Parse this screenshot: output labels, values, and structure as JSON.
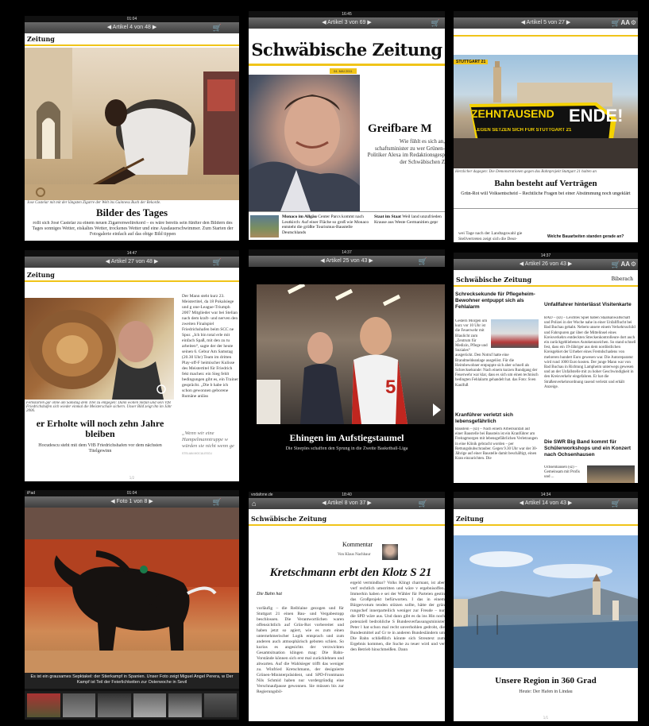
{
  "tiles": [
    {
      "time": "01:04",
      "nav": "Artikel 4 von 48",
      "masthead": "Zeitung",
      "caption": "Jose Castelar mit mit der längsten Zigarre der Welt ins Guinness Buch der Rekorde.",
      "headline": "Bilder des Tages",
      "body": "rollt sich José Castelar zu einem neuen Zigarrenweltrekord – es wäre bereits sein fünfter den Bildern des Tages sonniges Wetter, eiskaltes Wetter, trockenes Wetter und eine Ausdauerschwimmer. Zum Starten der Fotogalerie einfach auf das obige Bild tippen"
    },
    {
      "time": "16:45",
      "nav": "Artikel 3 von 69",
      "masthead": "Schwäbische Zeitung",
      "date": "04. MAI 2011",
      "headline": "Greifbare M",
      "body": "Wie fühlt es sich an, schaftsminister zu wer Grünen-Politiker Alexa im Redaktionsgesp der Schwäbischen Z",
      "teaser1_title": "Monaco im Allgäu",
      "teaser1": "Center Parcs kommt nach Leutkirch: Auf einer Fläche so groß wie Monaco entsteht die größte Tourismus-Baustelle Deutschlands",
      "teaser2_title": "Staat im Staat",
      "teaser2": "Weil land unzufrieden Krause aus Weste Germanitien gepr"
    },
    {
      "time": "",
      "nav": "Artikel 5 von 27",
      "kicker": "STUTTGART 21",
      "banner1": "ZEHNTAUSEND",
      "banner2": "ENDE!",
      "banner3": "LEGEN SETZEN SICH FÜR STUTTGART 21",
      "caption": "Herzlicher dagegen: Die Demonstrationen gegen das Bahnprojekt Stuttgart 21 halten an",
      "headline": "Bahn besteht auf Verträgen",
      "sub": "Grün-Rot will Volksentscheid – Rechtliche Fragen bei einer Abstimmung noch ungeklärt",
      "body": "wei Tage nach der Landtagswahl gie Stellvertreten zeigt sich die Deut-",
      "aside": "Welche Bauarbeiten standen gerade an?"
    },
    {
      "time": "14:47",
      "nav": "Artikel 27 von 48",
      "masthead": "Zeitung",
      "caption": "Fehlstarten gar ohne am Samstag dem Titel zu entgegen: Dann wollen Stefan und sein VfB Friedrichshafen sich wieder einmal die Meisterschale sichern. Unser Bild zeigt ihn im Jahr 2006.",
      "headline": "er Erholte will noch zehn Jahre bleiben",
      "sub": "Hocudescu steht mit dem VfB Friedrichshafen vor dem nächsten Titelgewinn",
      "col": "Der Mann steht kurz 23. Meistertitel, da 18 Pokalsiege und g one-League-Triumph 2007 Mitglieder war bei Stelian nach dem kraft- und nerven den zweiten Finalspiel Friedrichshafen beim SCC ne Spur. „Ich bin total erle mit einfach Spaß, mit den zu tu arbeiten“, sagte der der heute seinen 6. Gebur Am Samstag (20.30 Uhr) Team im dritten Play-off-F heimischer Kulisse des Meistertitel für Friedrich fekt machen: ein Sieg fehlt bedingungen gibt es, ein Trainer gesprächt. „Die b habe ich schon gewonnen geborene Rumäne anläss",
      "quote": "„Wenn wir eine Hampelmanntruppe w würden sie nicht wenn ge",
      "quote_by": "STELIAN MOCULESCU",
      "page": "1/2"
    },
    {
      "time": "14:37",
      "nav": "Artikel 25 von 43",
      "jersey": "5",
      "headline": "Ehingen im Aufstiegstaumel",
      "sub": "Die Steeples schaffen den Sprung in die Zweite Basketball-Liga"
    },
    {
      "time": "14:37",
      "nav": "Artikel 26 von 43",
      "masthead": "Schwäbische Zeitung",
      "region": "Biberach",
      "left": [
        {
          "title": "Schrecksekunde für Pflegeheim-Bewohner entpuppt sich als Fehlalarm",
          "body": "Gestern Morgen um kurz vor 10 Uhr ist die Feuerwehr mit Blaulicht zum „Zentrum für Medizin, Pflege und Soziales“ ausgerückt. Den Notruf hatte eine Brandmeldeanlage ausgelöst. Für die Heimbewohner entpuppte sich aber schnell als Schrecksekunde: Nach einem kurzen Rundgang der Feuerwehr war klar, dass es sich um einen technisch bedingten Fehlalarm gehandelt hat. das Foto: Sven Kaulfuß"
        },
        {
          "title": "Kranführer verletzt sich lebensgefährlich",
          "body": "Baustein – (sz) – Nach einem Arbeitsunfall auf einer Baustelle bei Baustein ist ein Kranführer am Freitagmorgen mit lebensgefährlichen Verletzungen in eine Klinik gebracht worden – per Rettungshubschrauber. Gegen 9.30 Uhr war der 30-Jährige auf einer Baustelle damit beschäftigt, einen Kran einzurichten. Die"
        }
      ],
      "right": [
        {
          "title": "Unfallfahrer hinterlässt Visitenkarte",
          "body": "BAD – (sz) – Leichtes Spiel haben Staatsanwaltschaft und Polizei in der Woche nahe in einer Unfallflucht bei Bad Buchau gehabt. Nebem unsere einem Verkehrsschild und Fahrspuren gar über die Mittelinsel eines Kreisverkehrs entdeckten Streckenkontrolleure dort auch ein zurückgebliebenes Autokennzeichen. So stand schnell fest, dass ein 19-Jähriger aus dem nordöstlichen Kreisgebiet der Urheber eines Fremdschadens von mehreren hundert Euro gewesen war. Die Autoreparatur wird rund 1000 Euro kosten. Der junge Mann war von Bad Buchau in Richtung Lampheim unterwegs gewesen und an der Unfallstelle mit zu hoher Geschwindigkeit in den Kreisverkehr eingefahren. Er hat die Straßenverkehrsordnung rasend verletzt und erhält Anzeige."
        },
        {
          "title": "Die SWR Big Band kommt für Schülerworkshops und ein Konzert nach Ochsenhausen",
          "body": "Ochsenhausen (sz) – Gemeinsam mit Profis und ..."
        }
      ]
    },
    {
      "carrier": "iPad",
      "time": "01:04",
      "nav": "Foto 1 von 8",
      "caption": "Es ist ein grausames Sepktakel: der Stierkampf in Spanien. Unser Foto zeigt Miguel Angel Perera, w Der Kampf ist Teil der Feierlichkeiten zur Osterwoche in Sevil"
    },
    {
      "carrier": "vodafone.de",
      "time": "18:40",
      "nav": "Artikel 8 von 37",
      "masthead": "Schwäbische Zeitung",
      "kicker": "Kommentar",
      "author": "Von Klaus Nachbaur",
      "headline": "Kretschmann erbt den Klotz S 21",
      "lead": "Die Bahn hat",
      "col1": "vorläufig – die Reiblaine gezogen und für Stuttgart 21 einen Bau- und Vergabestopp beschlossen. Die Verantwortlichen waren offensichtlich auf Grün-Rot vorbereitet und haben jetzt so agiert, wie es zum einen unternehmerischer Logik entsprach und zum anderen auch atmosphärisch geboten schien. So kurios es angesichts der verzwickten Gesamtsituation klingen mag: Die Bahn-Vorstände können sich erst mal zurücklehnen und abwarten. Auf die Wahlsieger trifft das weniger zu. Winfried Kretschmann, der designierte Grünen-Ministerpräsident, und SPD-Frontmann Nils Schmid haben nur vordergründig eine Verschnaufpause gewonnen. Sie müssen bis zur Regierungsbil-",
      "col2": "ergeld vermindbar? Volks Klingt charmant, ist aber verf rechtlich umstritten und wäre v ergebnisoffen. Immerhin haben e sei der Wähler für Parteien gestin das Großprojekt befürworten. I das in einem Bürgervotum tenden stützen sollte, hätte der grün rungschef innerparteilich weniger zur Freude – nur die SPD wäre aus. Und dann gibt es da ins Hin noch potenziell bedrohliche S Bundesverfassungsminister Peter l hat schon mal recht unverhohlen gedroht, die Bundesmittel auf Gr te in anderen Bundesländern um Die Bahn schließlich könnte sich Streutext zum Ergebnis kommen, die Suche zu teuer wird und ver den Betrieb hinschmeißen. Dann"
    },
    {
      "time": "14:34",
      "nav": "Artikel 14 von 43",
      "masthead": "Zeitung",
      "headline": "Unsere Region in 360 Grad",
      "sub": "Heute: Der Hafen in Lindau",
      "page": "1/1"
    }
  ]
}
